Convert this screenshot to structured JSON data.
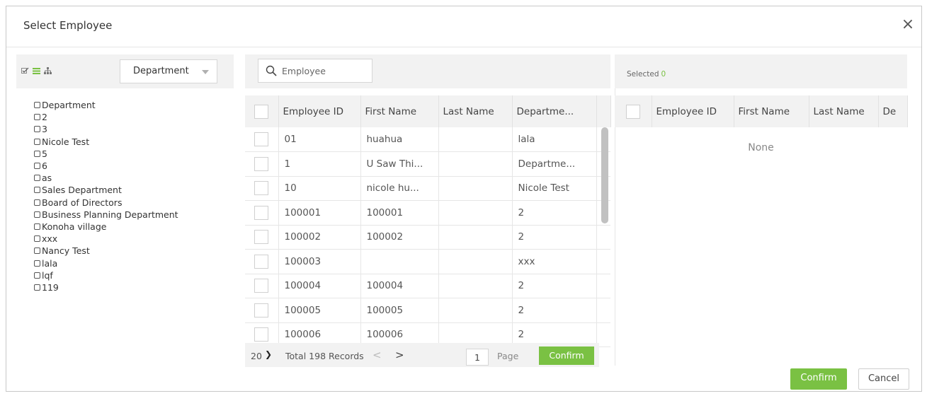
{
  "dialog": {
    "title": "Select Employee",
    "close_icon": "×"
  },
  "tree": {
    "view_icons": [
      "checkbox-view-icon",
      "list-view-icon",
      "org-chart-icon"
    ],
    "dropdown_value": "Department",
    "items": [
      "Department",
      "2",
      "3",
      "Nicole Test",
      "5",
      "6",
      "as",
      "Sales Department",
      "Board of Directors",
      "Business Planning Department",
      "Konoha village",
      "xxx",
      "Nancy Test",
      "lala",
      "lqf",
      "119"
    ]
  },
  "search": {
    "placeholder": "Employee"
  },
  "grid": {
    "columns": [
      "Employee ID",
      "First Name",
      "Last Name",
      "Departme..."
    ],
    "rows": [
      [
        "01",
        "huahua",
        "",
        "lala"
      ],
      [
        "1",
        "U Saw Thi...",
        "",
        "Departme..."
      ],
      [
        "10",
        "nicole hu...",
        "",
        "Nicole Test"
      ],
      [
        "100001",
        "100001",
        "",
        "2"
      ],
      [
        "100002",
        "100002",
        "",
        "2"
      ],
      [
        "100003",
        "",
        "",
        "xxx"
      ],
      [
        "100004",
        "100004",
        "",
        "2"
      ],
      [
        "100005",
        "100005",
        "",
        "2"
      ],
      [
        "100006",
        "100006",
        "",
        "2"
      ]
    ]
  },
  "pager": {
    "page_size": "20",
    "total": "Total 198 Records",
    "prev": "<",
    "next": ">",
    "page": "1",
    "page_label": "Page",
    "go_label": "Confirm"
  },
  "selected": {
    "label": "Selected",
    "count": "0",
    "columns": [
      "Employee ID",
      "First Name",
      "Last Name",
      "De"
    ],
    "empty_text": "None"
  },
  "footer": {
    "confirm_label": "Confirm",
    "cancel_label": "Cancel"
  },
  "colors": {
    "accent_green": "#7ac143",
    "header_gray": "#f2f2f2",
    "border_gray": "#e6e6e6"
  }
}
